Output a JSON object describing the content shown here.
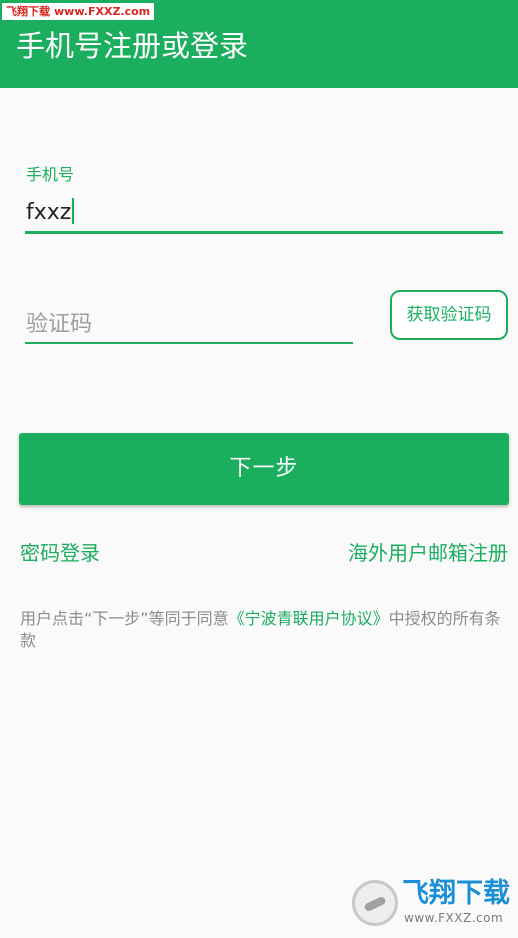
{
  "watermark": {
    "top_brand": "飞翔下载",
    "top_site": "www.FXXZ.com",
    "bottom_brand": "飞翔下载",
    "bottom_site": "www.FXXZ.com"
  },
  "app_bar": {
    "title": "手机号注册或登录"
  },
  "form": {
    "phone_label": "手机号",
    "phone_value": "fxxz",
    "code_placeholder": "验证码",
    "get_code_label": "获取验证码",
    "next_label": "下一步"
  },
  "links": {
    "password_login": "密码登录",
    "overseas_email_register": "海外用户邮箱注册"
  },
  "agreement": {
    "prefix": "用户点击“下一步”等同于同意",
    "protocol": "《宁波青联用户协议》",
    "suffix": "中授权的所有条款"
  },
  "colors": {
    "accent": "#1aae5e",
    "background": "#fafafa",
    "hint": "#9e9e9e"
  }
}
